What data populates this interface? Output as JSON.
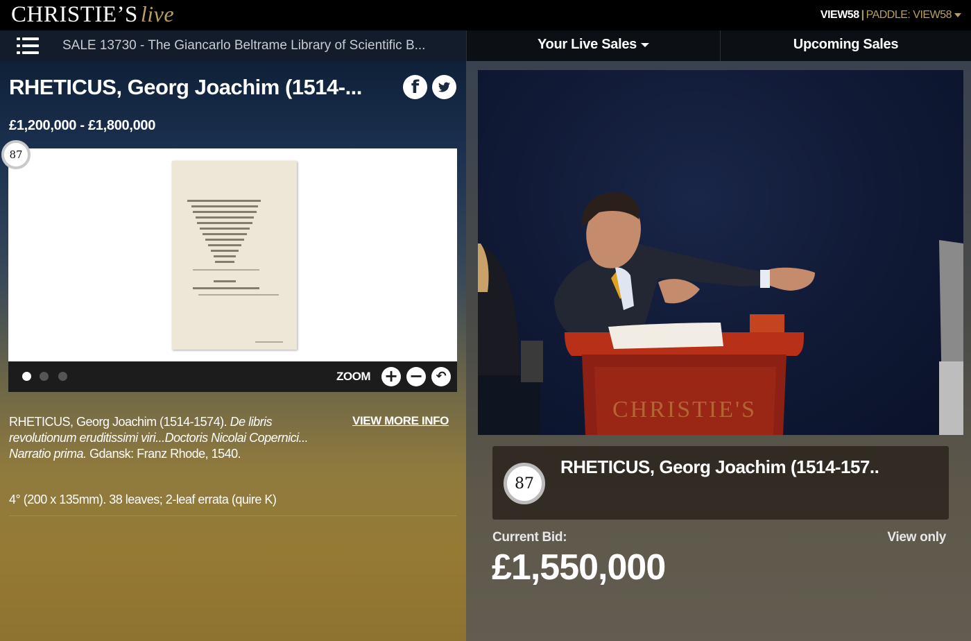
{
  "brand": {
    "name": "CHRISTIE’S",
    "suffix": "live"
  },
  "account": {
    "user": "VIEW58",
    "separator": "|",
    "paddle": "PADDLE: VIEW58"
  },
  "sale": {
    "title": "SALE 13730 - The Giancarlo Beltrame Library of Scientific B..."
  },
  "tabs": {
    "live_sales": "Your Live Sales",
    "upcoming": "Upcoming Sales"
  },
  "lot": {
    "number": "87",
    "title": "RHETICUS, Georg Joachim (1514-...",
    "card_title": "RHETICUS, Georg Joachim (1514-157..",
    "estimate": "£1,200,000 - £1,800,000",
    "social": {
      "facebook": "f",
      "twitter": "t"
    },
    "description": {
      "author": "RHETICUS, Georg Joachim (1514-1574).",
      "work": "De libris revolutionum eruditissimi viri...Doctoris Nicolai Copernici... Narratio prima.",
      "imprint": "Gdansk: Franz Rhode, 1540."
    },
    "collation": "4° (200 x 135mm). 38 leaves; 2-leaf errata (quire K)",
    "view_more": "VIEW MORE INFO"
  },
  "viewer": {
    "zoom_label": "ZOOM",
    "zoom_in": "+",
    "zoom_out": "−",
    "reset": "↶",
    "image_count": 3,
    "active_image": 1
  },
  "bidding": {
    "label": "Current Bid:",
    "amount": "£1,550,000",
    "status": "View only"
  },
  "colors": {
    "gold_accent": "#b8a060",
    "top_bar": "#000000",
    "sale_bar": "#121c2b"
  },
  "icons": [
    "hamburger-icon",
    "facebook-icon",
    "twitter-icon",
    "zoom-in-icon",
    "zoom-out-icon",
    "reset-icon",
    "chevron-down-icon"
  ]
}
